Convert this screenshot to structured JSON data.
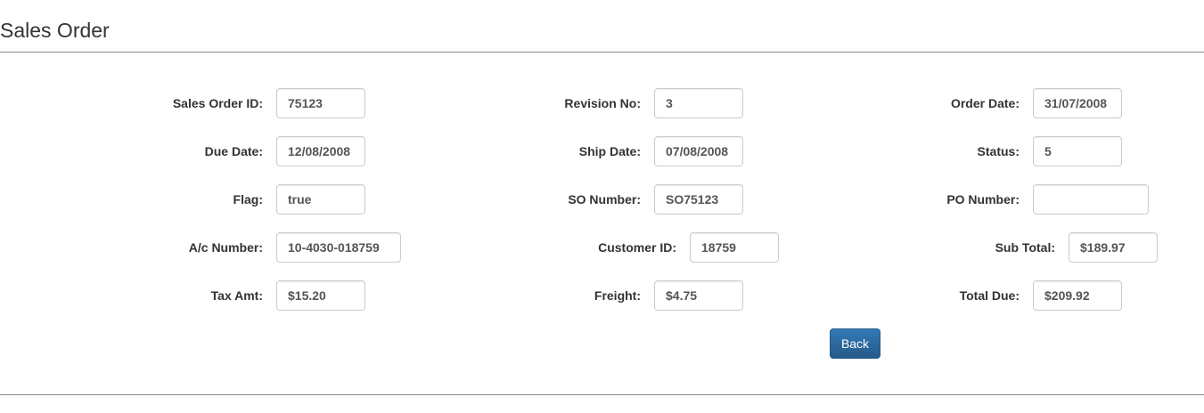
{
  "header": {
    "title": "Sales Order"
  },
  "fields": {
    "sales_order_id": {
      "label": "Sales Order ID:",
      "value": "75123"
    },
    "revision_no": {
      "label": "Revision No:",
      "value": "3"
    },
    "order_date": {
      "label": "Order Date:",
      "value": "31/07/2008"
    },
    "due_date": {
      "label": "Due Date:",
      "value": "12/08/2008"
    },
    "ship_date": {
      "label": "Ship Date:",
      "value": "07/08/2008"
    },
    "status": {
      "label": "Status:",
      "value": "5"
    },
    "flag": {
      "label": "Flag:",
      "value": "true"
    },
    "so_number": {
      "label": "SO Number:",
      "value": "SO75123"
    },
    "po_number": {
      "label": "PO Number:",
      "value": ""
    },
    "ac_number": {
      "label": "A/c Number:",
      "value": "10-4030-018759"
    },
    "customer_id": {
      "label": "Customer ID:",
      "value": "18759"
    },
    "sub_total": {
      "label": "Sub Total:",
      "value": "$189.97"
    },
    "tax_amt": {
      "label": "Tax Amt:",
      "value": "$15.20"
    },
    "freight": {
      "label": "Freight:",
      "value": "$4.75"
    },
    "total_due": {
      "label": "Total Due:",
      "value": "$209.92"
    }
  },
  "actions": {
    "back_label": "Back"
  },
  "colors": {
    "primary_button": "#337ab7",
    "input_border": "#cccccc",
    "divider": "#8a8a8a"
  }
}
